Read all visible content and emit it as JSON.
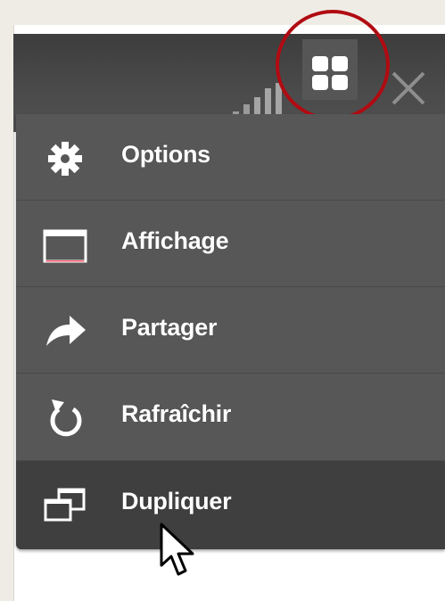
{
  "toolbar": {
    "icons": [
      "signal-bars-icon",
      "grid-layout-icon",
      "close-icon"
    ]
  },
  "menu": {
    "items": [
      {
        "label": "Options",
        "icon": "gear-icon"
      },
      {
        "label": "Affichage",
        "icon": "window-icon"
      },
      {
        "label": "Partager",
        "icon": "share-arrow-icon"
      },
      {
        "label": "Rafraîchir",
        "icon": "refresh-icon"
      },
      {
        "label": "Dupliquer",
        "icon": "duplicate-icon",
        "state": "hovered"
      }
    ]
  },
  "colors": {
    "toolbar": "#444444",
    "menu_background": "#575757",
    "menu_hover": "#3f3f3f",
    "highlight_circle": "#b10b12",
    "icon_accent": "#ff5b6e"
  }
}
